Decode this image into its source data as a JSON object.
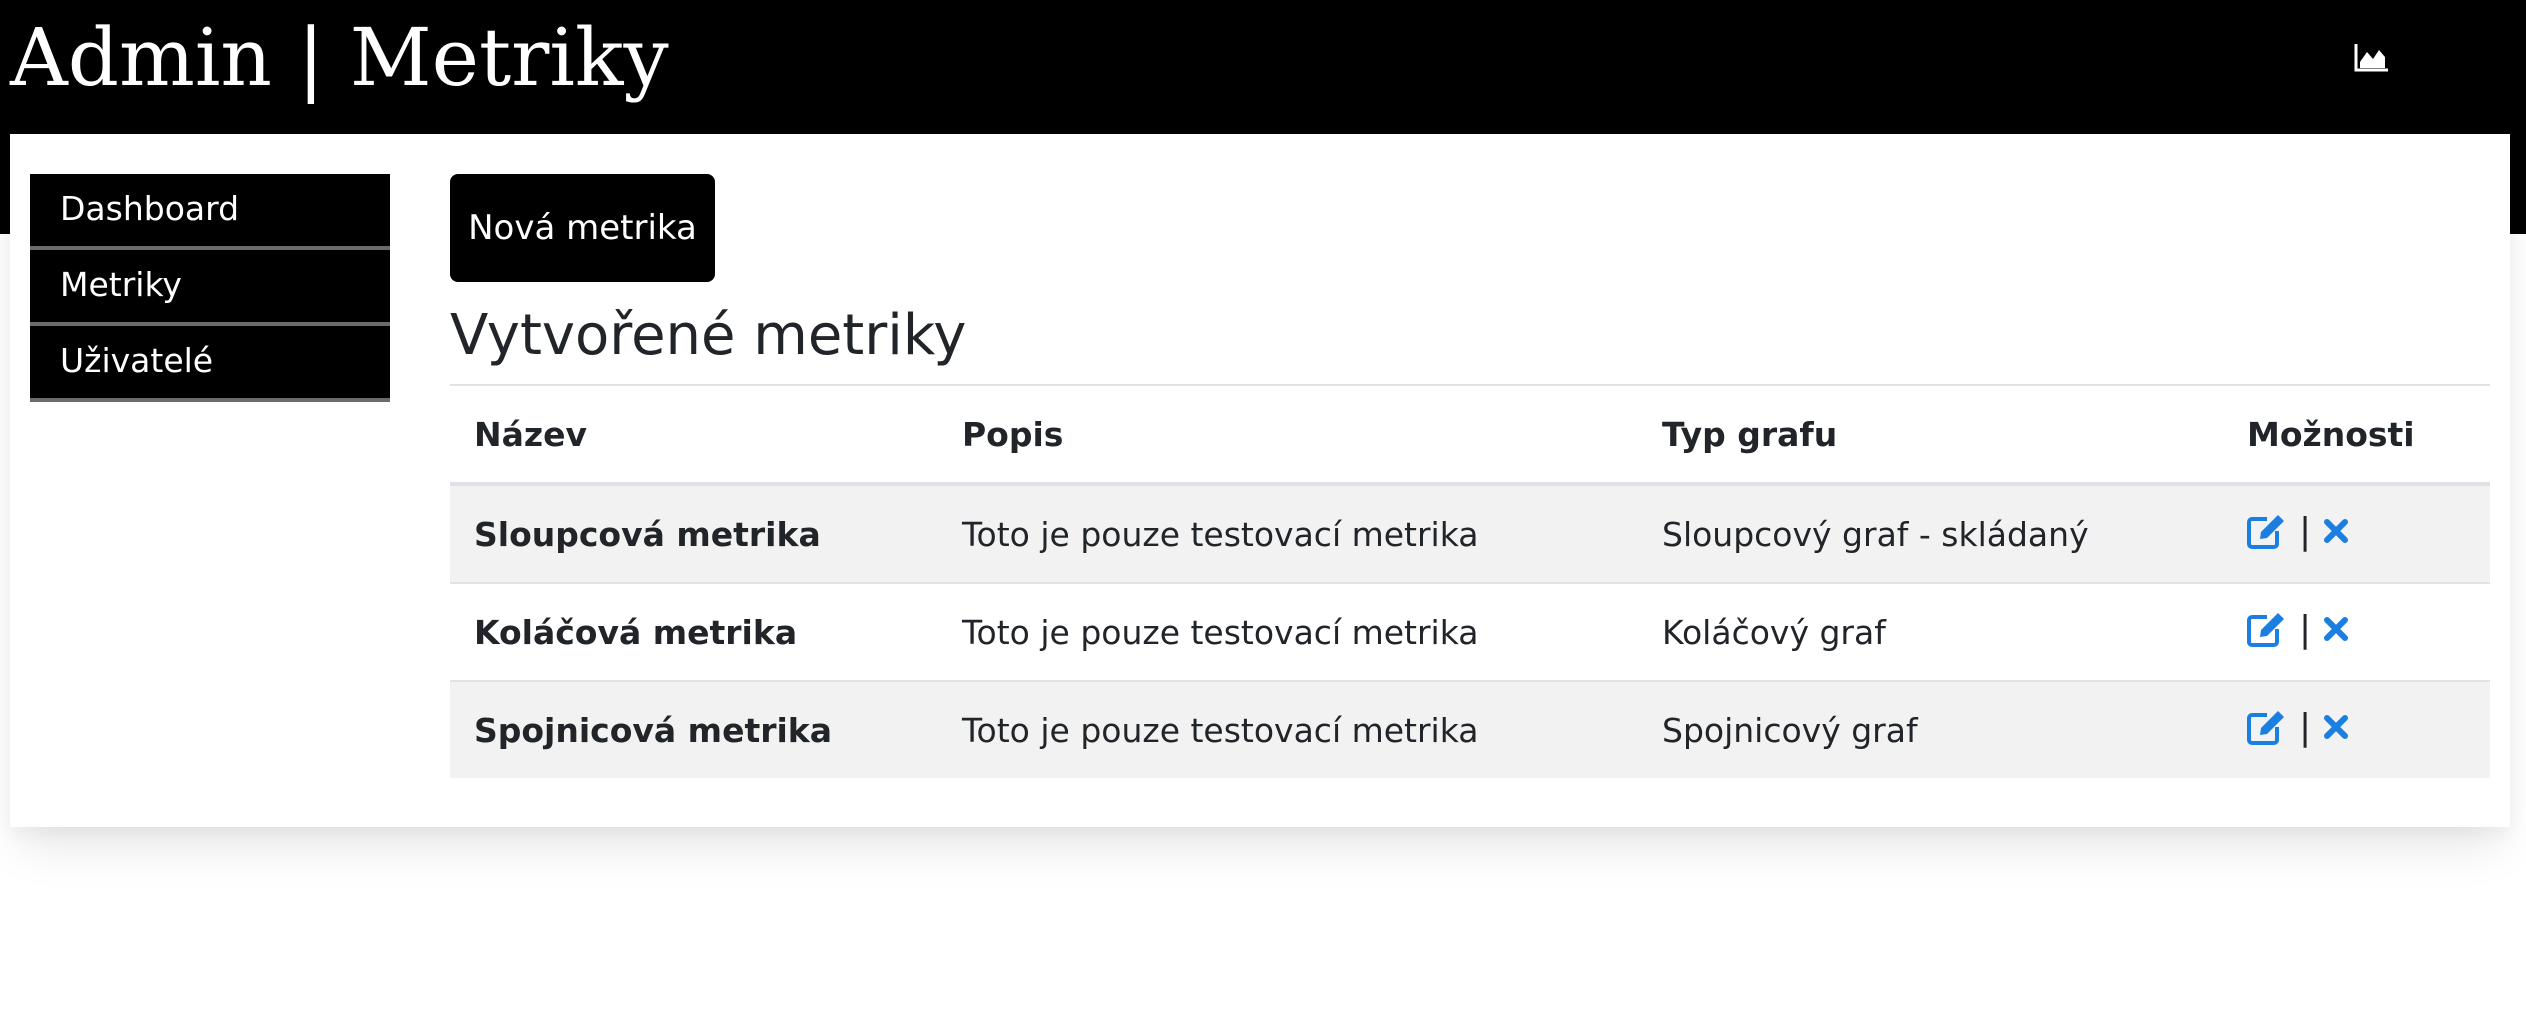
{
  "header": {
    "title": "Admin | Metriky",
    "icon": "area-chart-icon"
  },
  "sidebar": {
    "items": [
      {
        "label": "Dashboard"
      },
      {
        "label": "Metriky"
      },
      {
        "label": "Uživatelé"
      }
    ]
  },
  "main": {
    "new_button": "Nová metrika",
    "section_title": "Vytvořené metriky",
    "table": {
      "headers": [
        "Název",
        "Popis",
        "Typ grafu",
        "Možnosti"
      ],
      "rows": [
        {
          "name": "Sloupcová metrika",
          "description": "Toto je pouze testovací metrika",
          "chart_type": "Sloupcový graf - skládaný"
        },
        {
          "name": "Koláčová metrika",
          "description": "Toto je pouze testovací metrika",
          "chart_type": "Koláčový graf"
        },
        {
          "name": "Spojnicová metrika",
          "description": "Toto je pouze testovací metrika",
          "chart_type": "Spojnicový graf"
        }
      ],
      "options_separator": "|",
      "option_icons": [
        "edit-icon",
        "delete-icon"
      ]
    }
  },
  "colors": {
    "header_bg": "#000000",
    "accent": "#1a7fe0",
    "row_stripe": "#f2f2f2"
  }
}
